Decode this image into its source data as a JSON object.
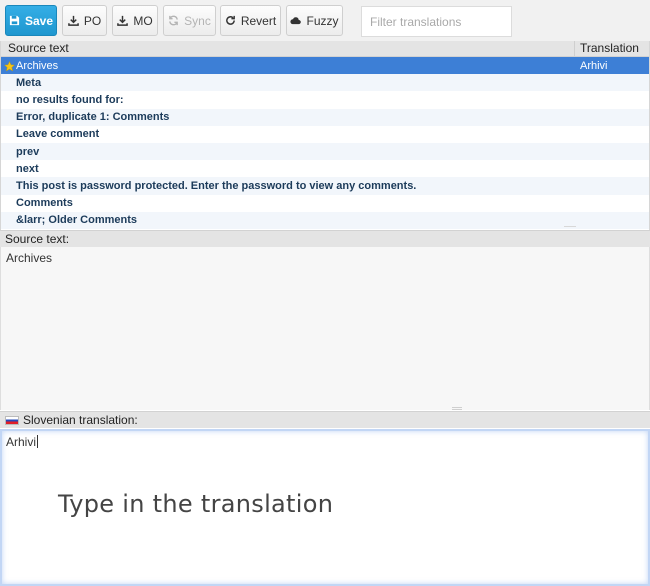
{
  "toolbar": {
    "save_label": "Save",
    "po_label": "PO",
    "mo_label": "MO",
    "sync_label": "Sync",
    "revert_label": "Revert",
    "fuzzy_label": "Fuzzy",
    "filter_placeholder": "Filter translations"
  },
  "grid": {
    "columns": [
      "Source text",
      "Translation"
    ],
    "rows": [
      {
        "source": "Archives",
        "translation": "Arhivi",
        "selected": true,
        "starred": true
      },
      {
        "source": "Meta",
        "translation": ""
      },
      {
        "source": "no results found for:",
        "translation": ""
      },
      {
        "source": "Error, duplicate 1: Comments",
        "translation": ""
      },
      {
        "source": "Leave comment",
        "translation": ""
      },
      {
        "source": "prev",
        "translation": ""
      },
      {
        "source": "next",
        "translation": ""
      },
      {
        "source": "This post is password protected. Enter the password to view any comments.",
        "translation": ""
      },
      {
        "source": "Comments",
        "translation": ""
      },
      {
        "source": "&larr; Older Comments",
        "translation": ""
      }
    ]
  },
  "source_pane": {
    "label": "Source text:",
    "text": "Archives"
  },
  "target_pane": {
    "label": "Slovenian translation:",
    "text": "Arhivi",
    "flag": "slovenia-flag-icon"
  },
  "hint": "Type in the translation",
  "colors": {
    "primary": "#1f97cf",
    "selected_row": "#3d7fd6",
    "source_text": "#1c3b5a"
  }
}
